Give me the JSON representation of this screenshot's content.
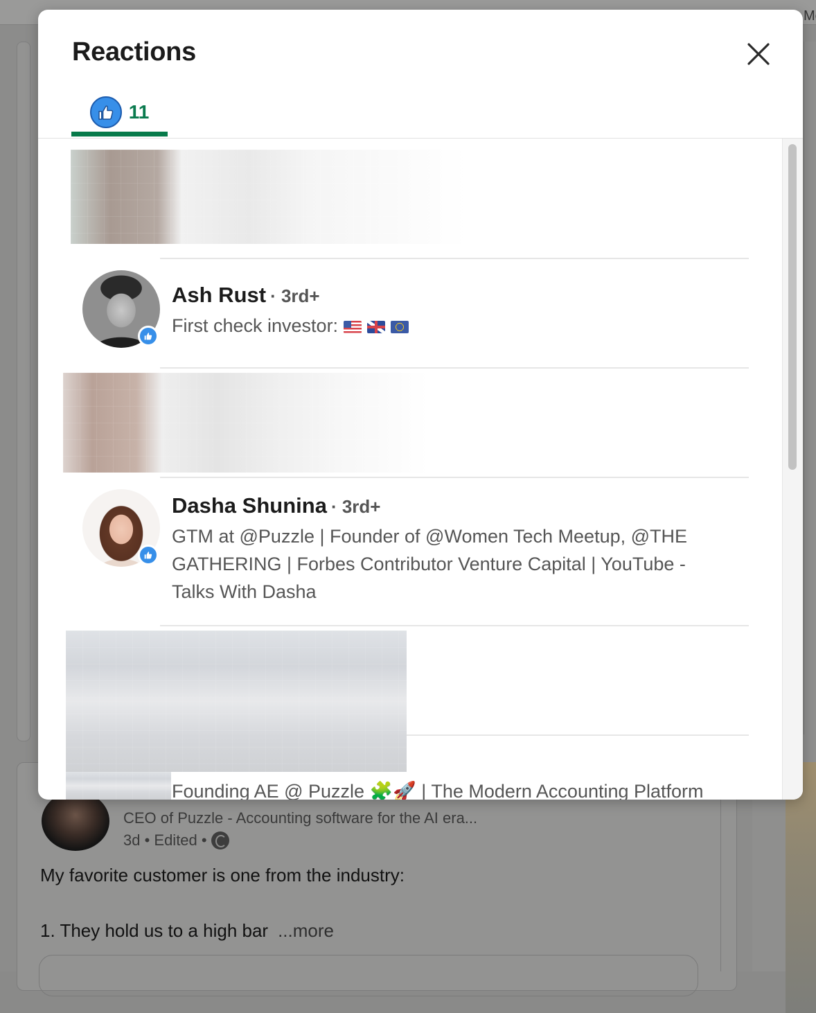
{
  "modal": {
    "title": "Reactions",
    "tabs": [
      {
        "label": "11",
        "icon": "like-icon",
        "selected": true
      }
    ]
  },
  "reactors": [
    {
      "name": "Ash Rust",
      "degree": "· 3rd+",
      "headline": "First check investor:",
      "reaction": "like-icon"
    },
    {
      "name": "Dasha Shunina",
      "degree": "· 3rd+",
      "headline": "GTM at @Puzzle | Founder of @Women Tech Meetup, @THE GATHERING | Forbes Contributor Venture Capital | YouTube - Talks With Dasha",
      "reaction": "like-icon"
    },
    {
      "headline": "Founding AE @ Puzzle 🧩🚀 | The Modern Accounting Platform"
    }
  ],
  "background_post": {
    "author_subtitle": "CEO of Puzzle - Accounting software for the AI era...",
    "meta": "3d • Edited •",
    "text": "My favorite customer is one from the industry:",
    "list_item": "1. They hold us to a high bar",
    "more_label": "...more"
  },
  "colors": {
    "accent_green": "#077a4a",
    "like_blue": "#378fe9"
  }
}
